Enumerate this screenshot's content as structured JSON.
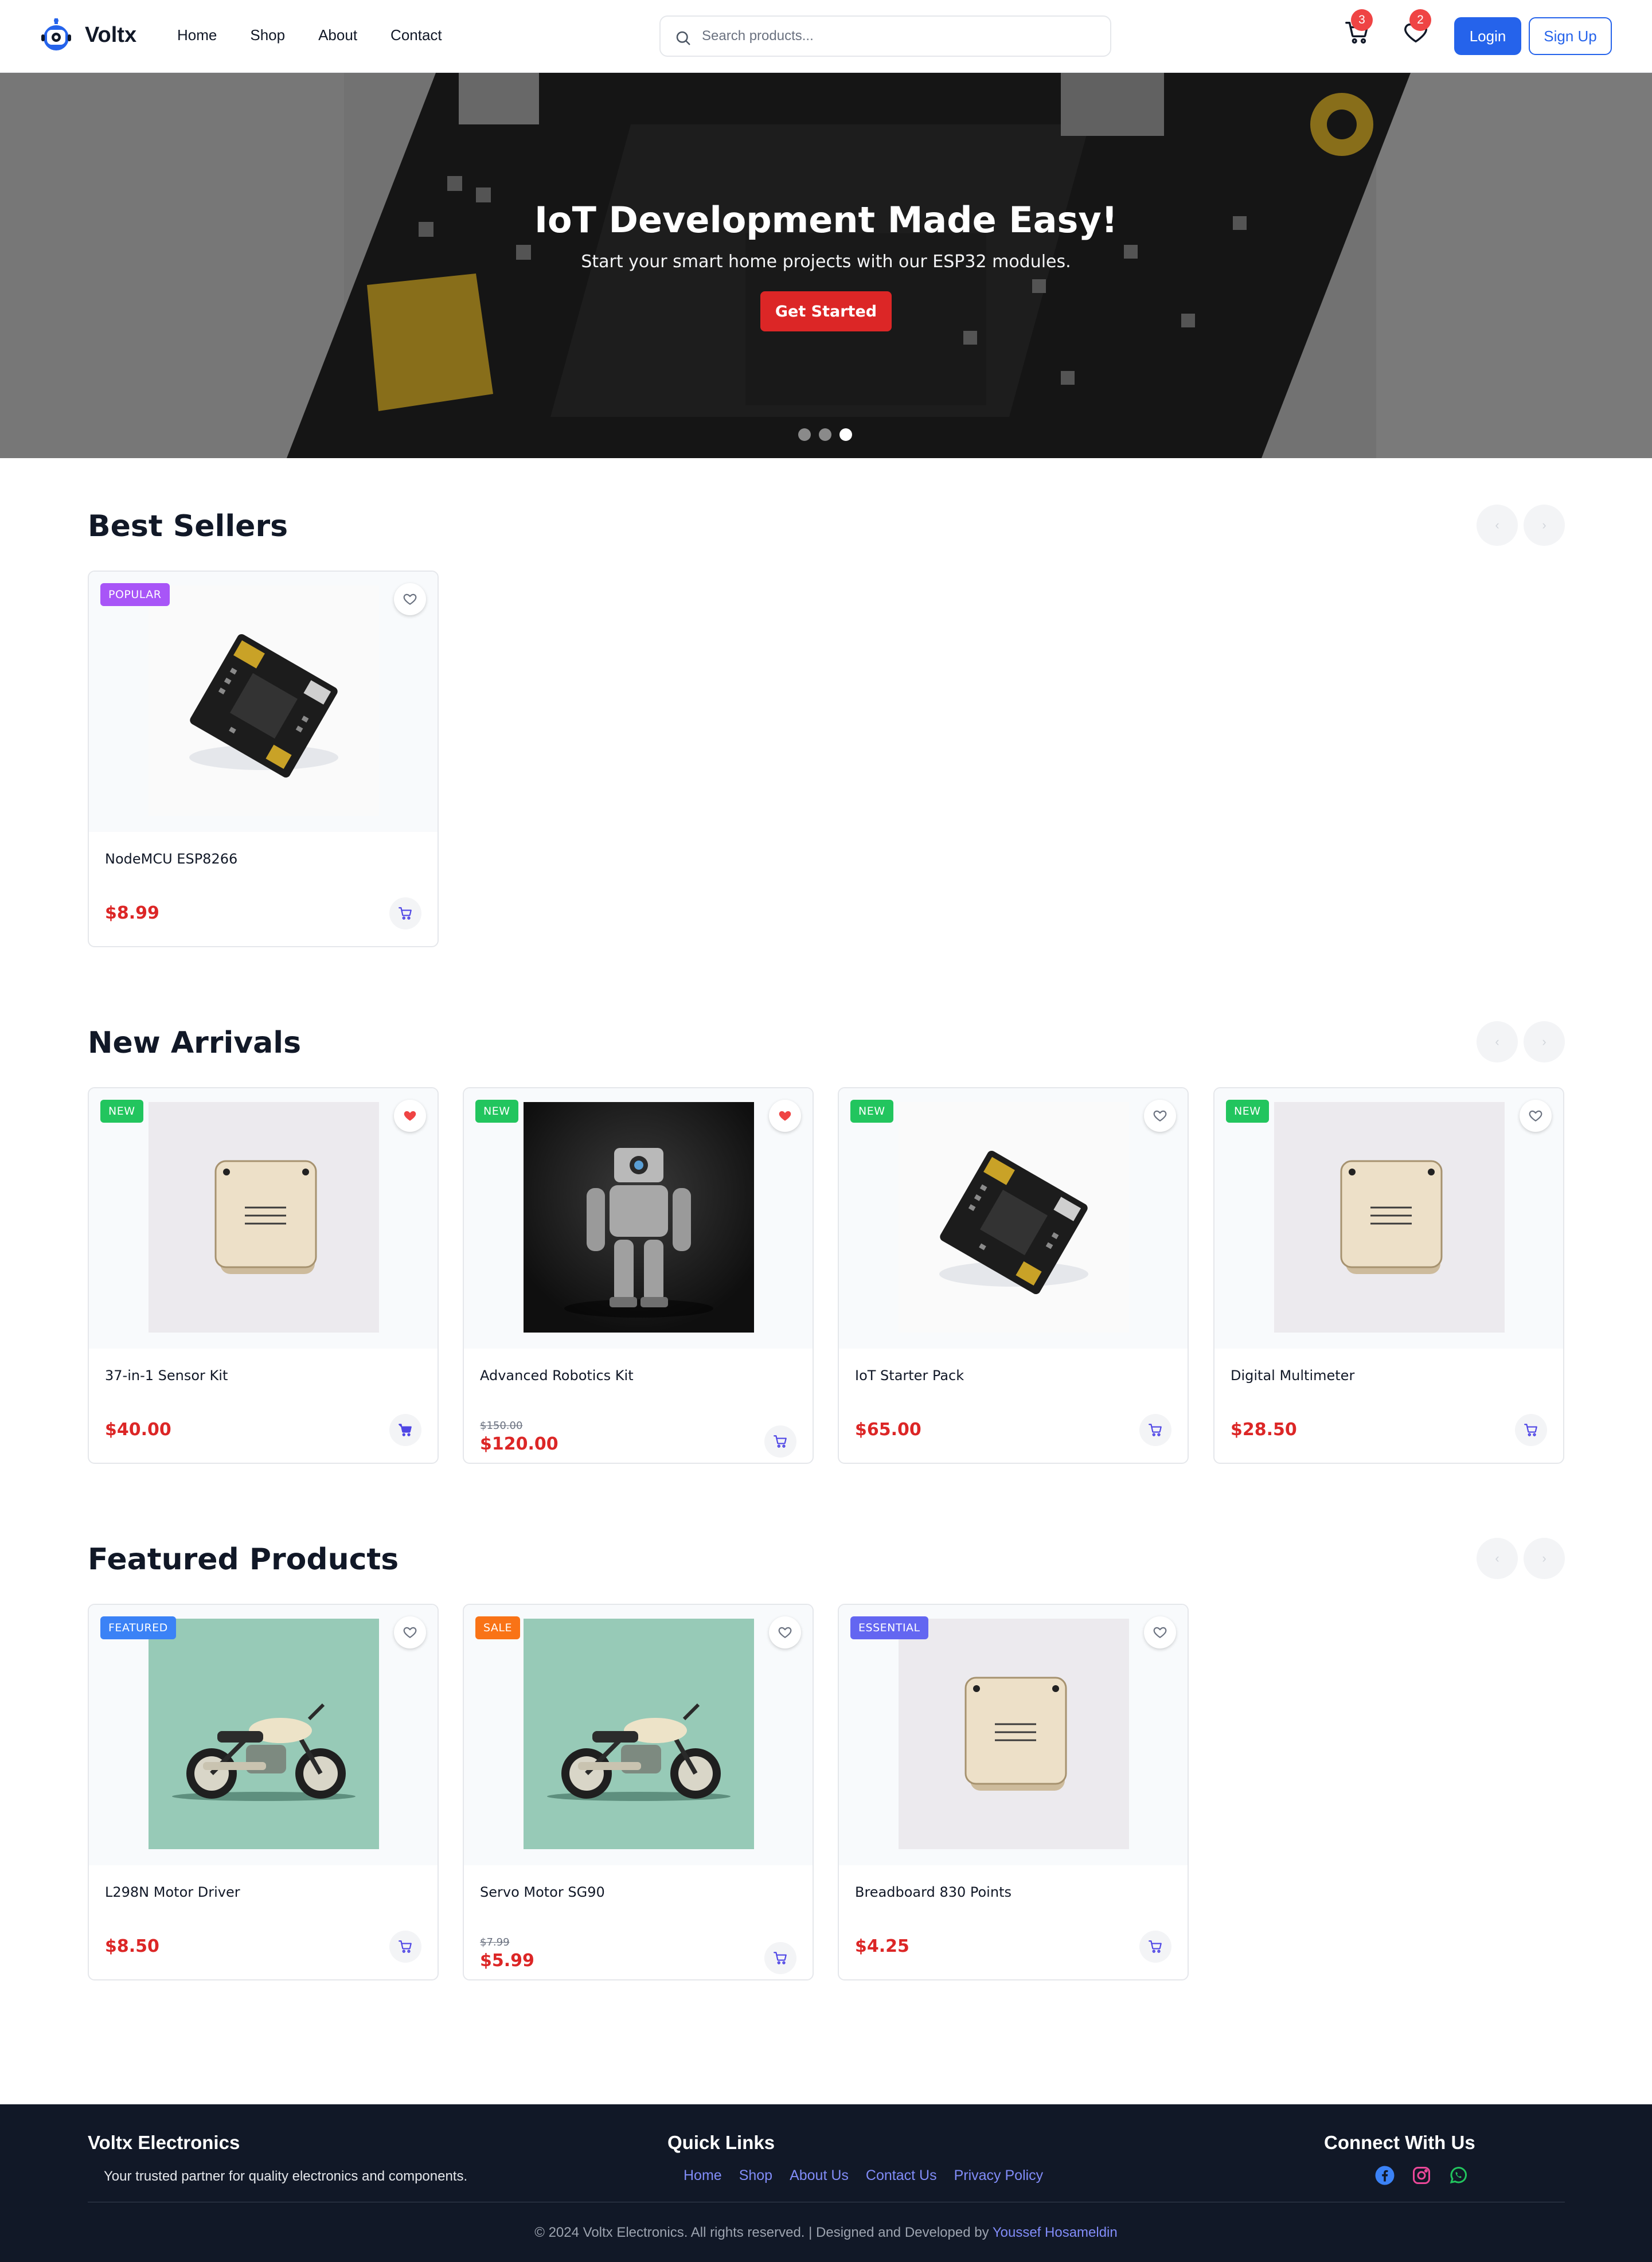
{
  "header": {
    "brand": "Voltx",
    "nav": [
      "Home",
      "Shop",
      "About",
      "Contact"
    ],
    "search_placeholder": "Search products...",
    "cart_count": "3",
    "wishlist_count": "2",
    "login_label": "Login",
    "signup_label": "Sign Up"
  },
  "hero": {
    "title": "IoT Development Made Easy!",
    "subtitle": "Start your smart home projects with our ESP32 modules.",
    "cta": "Get Started",
    "slides": 3,
    "active_slide": 3
  },
  "colors": {
    "accent": "#2563eb",
    "price": "#dc2626",
    "badge_popular": "#a855f7",
    "badge_new": "#22c55e",
    "badge_featured": "#3b82f6",
    "badge_sale": "#f97316",
    "badge_essential": "#6366f1",
    "footer_bg": "#111827"
  },
  "sections": {
    "best": {
      "title": "Best Sellers",
      "products": [
        {
          "name": "NodeMCU ESP8266",
          "price": "$8.99",
          "tag": "POPULAR",
          "image": "circuit-board-image",
          "wishlisted": false
        }
      ]
    },
    "arrivals": {
      "title": "New Arrivals",
      "products": [
        {
          "name": "37-in-1 Sensor Kit",
          "price": "$40.00",
          "tag": "NEW",
          "image": "beige-device-image",
          "wishlisted": true
        },
        {
          "name": "Advanced Robotics Kit",
          "old_price": "$150.00",
          "price": "$120.00",
          "tag": "NEW",
          "image": "robot-image",
          "wishlisted": true
        },
        {
          "name": "IoT Starter Pack",
          "price": "$65.00",
          "tag": "NEW",
          "image": "circuit-board-image",
          "wishlisted": false
        },
        {
          "name": "Digital Multimeter",
          "price": "$28.50",
          "tag": "NEW",
          "image": "beige-device-image",
          "wishlisted": false
        }
      ]
    },
    "featured": {
      "title": "Featured Products",
      "products": [
        {
          "name": "L298N Motor Driver",
          "price": "$8.50",
          "tag": "FEATURED",
          "image": "motorcycle-image",
          "wishlisted": false
        },
        {
          "name": "Servo Motor SG90",
          "old_price": "$7.99",
          "price": "$5.99",
          "tag": "SALE",
          "image": "motorcycle-image",
          "wishlisted": false
        },
        {
          "name": "Breadboard 830 Points",
          "price": "$4.25",
          "tag": "ESSENTIAL",
          "image": "beige-device-image",
          "wishlisted": false
        }
      ]
    }
  },
  "footer": {
    "about_title": "Voltx Electronics",
    "about_text": "Your trusted partner for quality electronics and components.",
    "links_title": "Quick Links",
    "links": [
      "Home",
      "Shop",
      "About Us",
      "Contact Us",
      "Privacy Policy"
    ],
    "social_title": "Connect With Us",
    "social_icons": [
      "facebook-icon",
      "instagram-icon",
      "whatsapp-icon"
    ],
    "copyright": "© 2024 Voltx Electronics. All rights reserved. | Designed and Developed by",
    "author": "Youssef Hosameldin"
  }
}
